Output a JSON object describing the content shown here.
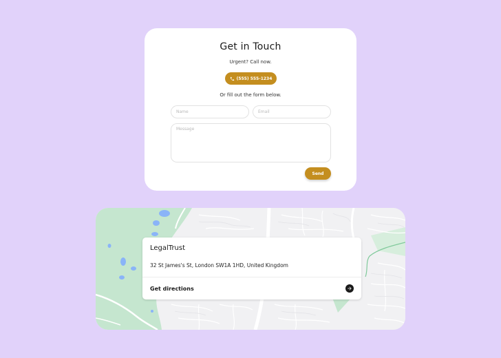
{
  "contact": {
    "title": "Get in Touch",
    "urgent_text": "Urgent? Call now.",
    "phone_label": "(555) 555-1234",
    "form_intro": "Or fill out the form below.",
    "name_placeholder": "Name",
    "email_placeholder": "Email",
    "message_placeholder": "Message",
    "send_label": "Send"
  },
  "map": {
    "place_name": "LegalTrust",
    "address": "32 St James's St, London SW1A 1HD, United Kingdom",
    "directions_label": "Get directions"
  },
  "colors": {
    "background": "#e1d2fa",
    "accent": "#c48e1f",
    "map_park": "#c5e6cf",
    "map_water": "#8ab4f8"
  },
  "icons": {
    "phone": "phone-icon",
    "directions": "arrow-right-icon"
  }
}
